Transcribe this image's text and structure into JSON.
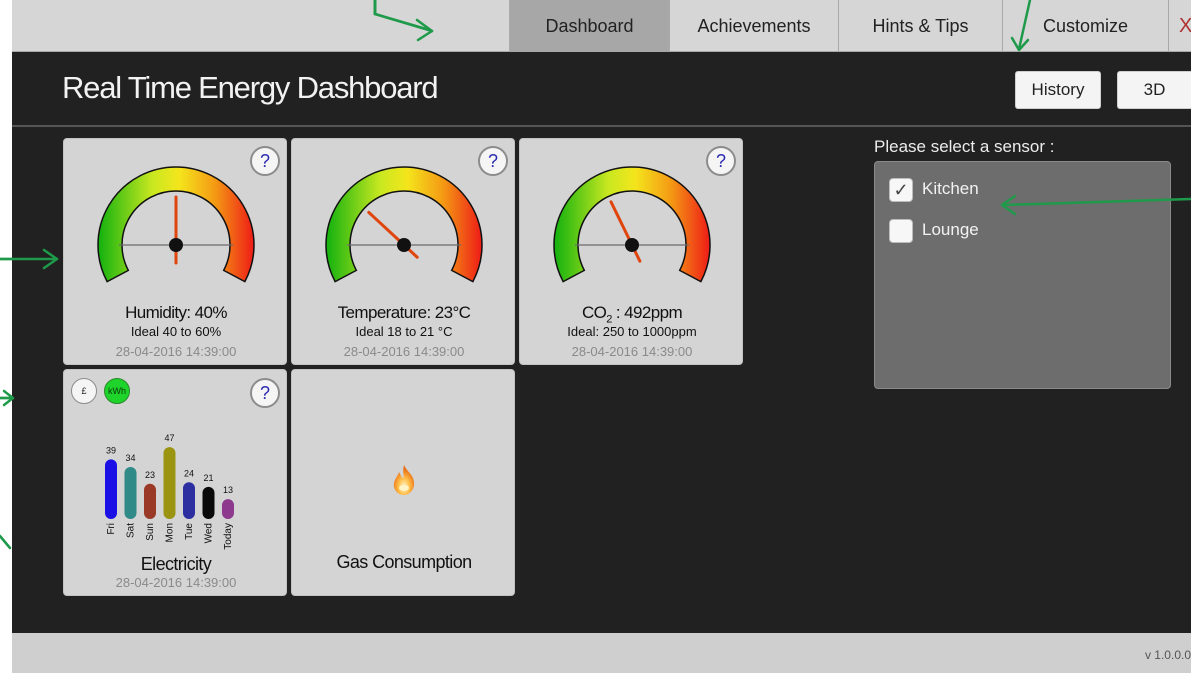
{
  "tabs": [
    {
      "label": "Dashboard",
      "active": true
    },
    {
      "label": "Achievements",
      "active": false
    },
    {
      "label": "Hints & Tips",
      "active": false
    },
    {
      "label": "Customize",
      "active": false
    }
  ],
  "close_label": "X",
  "header": {
    "title": "Real Time Energy Dashboard",
    "history_label": "History",
    "view3d_label": "3D"
  },
  "gauges": [
    {
      "main": "Humidity:  40%",
      "ideal": "Ideal 40 to 60%",
      "timestamp": "28-04-2016 14:39:00",
      "needle_fraction": 0.5
    },
    {
      "main": "Temperature: 23°C",
      "ideal": "Ideal 18 to 21 °C",
      "timestamp": "28-04-2016 14:39:00",
      "needle_fraction": 0.3
    },
    {
      "main_prefix": "CO",
      "main_sub": "2",
      "main_suffix": " : 492ppm",
      "ideal": "Ideal: 250 to 1000ppm",
      "timestamp": "28-04-2016 14:39:00",
      "needle_fraction": 0.39
    }
  ],
  "help_label": "?",
  "electricity": {
    "currency_label": "£",
    "kwh_label": "kWh",
    "title": "Electricity",
    "timestamp": "28-04-2016 14:39:00",
    "bars": [
      {
        "day": "Fri",
        "value": 39,
        "color": "#1a10e6"
      },
      {
        "day": "Sat",
        "value": 34,
        "color": "#2f8a88"
      },
      {
        "day": "Sun",
        "value": 23,
        "color": "#9a3a26"
      },
      {
        "day": "Mon",
        "value": 47,
        "color": "#9b9411"
      },
      {
        "day": "Tue",
        "value": 24,
        "color": "#2d2fa0"
      },
      {
        "day": "Wed",
        "value": 21,
        "color": "#0a0a0a"
      },
      {
        "day": "Today",
        "value": 13,
        "color": "#8d3a8e"
      }
    ]
  },
  "gas": {
    "title": "Gas Consumption"
  },
  "sensors": {
    "heading": "Please select a sensor :",
    "items": [
      {
        "label": "Kitchen",
        "checked": true
      },
      {
        "label": "Lounge",
        "checked": false
      }
    ],
    "check_glyph": "✓"
  },
  "footer": {
    "version": "v 1.0.0.0"
  },
  "colors": {
    "annotation_arrow": "#1e9a4a",
    "kwh_active": "#1ed32a"
  }
}
